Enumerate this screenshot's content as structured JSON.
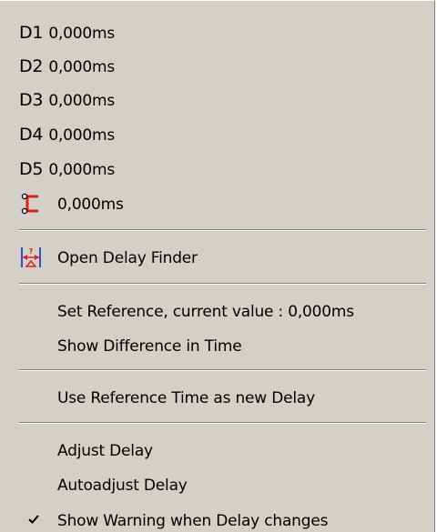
{
  "delays": [
    {
      "name": "D1",
      "value": "0,000ms"
    },
    {
      "name": "D2",
      "value": "0,000ms"
    },
    {
      "name": "D3",
      "value": "0,000ms"
    },
    {
      "name": "D4",
      "value": "0,000ms"
    },
    {
      "name": "D5",
      "value": "0,000ms"
    }
  ],
  "link_delay": {
    "value": "0,000ms",
    "icon": "red-bracket-link-icon"
  },
  "menu": {
    "open_delay_finder": "Open Delay Finder",
    "open_delay_finder_icon": "delay-finder-icon",
    "set_reference": "Set Reference, current value : 0,000ms",
    "show_difference": "Show Difference in Time",
    "use_reference": "Use Reference Time as new Delay",
    "adjust_delay": "Adjust Delay",
    "autoadjust_delay": "Autoadjust Delay",
    "show_warning": "Show Warning when Delay changes",
    "show_warning_checked": true
  },
  "colors": {
    "menu_bg": "#d4d0c8",
    "icon_red": "#e02020"
  }
}
